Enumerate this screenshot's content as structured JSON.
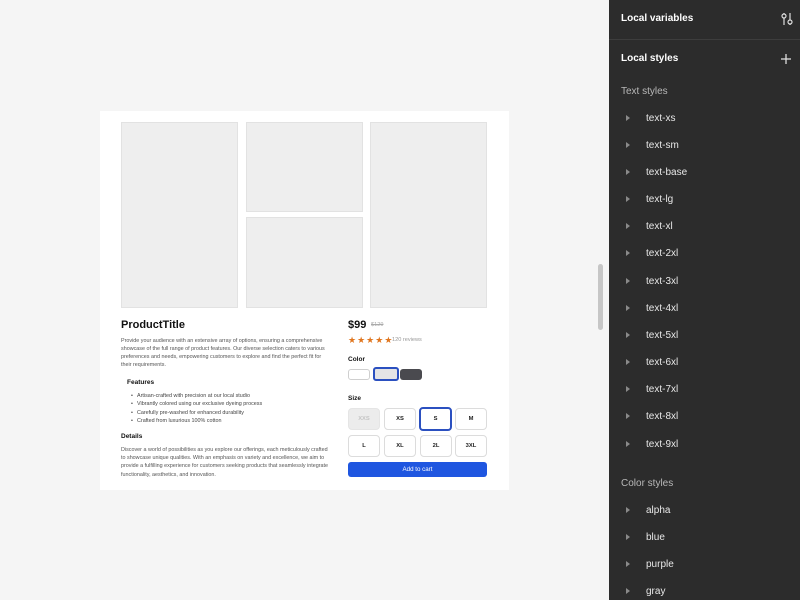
{
  "product": {
    "title": "ProductTitle",
    "description": "Provide your audience with an extensive array of options, ensuring a comprehensive showcase of the full range of product features. Our diverse selection caters to various preferences and needs, empowering customers to explore and find the perfect fit for their requirements.",
    "features_title": "Features",
    "features": [
      "Artisan-crafted with precision at our local studio",
      "Vibrantly colored using our exclusive dyeing process",
      "Carefully pre-washed for enhanced durability",
      "Crafted from luxurious 100% cotton"
    ],
    "details_title": "Details",
    "details": "Discover a world of possibilities as you explore our offerings, each meticulously crafted to showcase unique qualities. With an emphasis on variety and excellence, we aim to provide a fulfilling experience for customers seeking products that seamlessly integrate functionality, aesthetics, and innovation.",
    "price": "$99",
    "old_price": "$129",
    "rating": 5,
    "reviews": "120 reviews",
    "color_label": "Color",
    "colors": [
      "#ffffff",
      "#e4e4e6",
      "#4a4a4f"
    ],
    "selected_color_index": 1,
    "size_label": "Size",
    "sizes": [
      "XXS",
      "XS",
      "S",
      "M",
      "L",
      "XL",
      "2L",
      "3XL"
    ],
    "selected_size": "S",
    "disabled_size": "XXS",
    "cta": "Add to cart",
    "accent": "#1f56e0",
    "star_color": "#e0761f"
  },
  "panel": {
    "local_variables": "Local variables",
    "local_styles": "Local styles",
    "text_styles_title": "Text styles",
    "text_styles": [
      "text-xs",
      "text-sm",
      "text-base",
      "text-lg",
      "text-xl",
      "text-2xl",
      "text-3xl",
      "text-4xl",
      "text-5xl",
      "text-6xl",
      "text-7xl",
      "text-8xl",
      "text-9xl"
    ],
    "color_styles_title": "Color styles",
    "color_styles": [
      "alpha",
      "blue",
      "purple",
      "gray"
    ],
    "bg": "#2c2c2c",
    "icons": [
      "sliders-icon",
      "plus-icon"
    ]
  }
}
